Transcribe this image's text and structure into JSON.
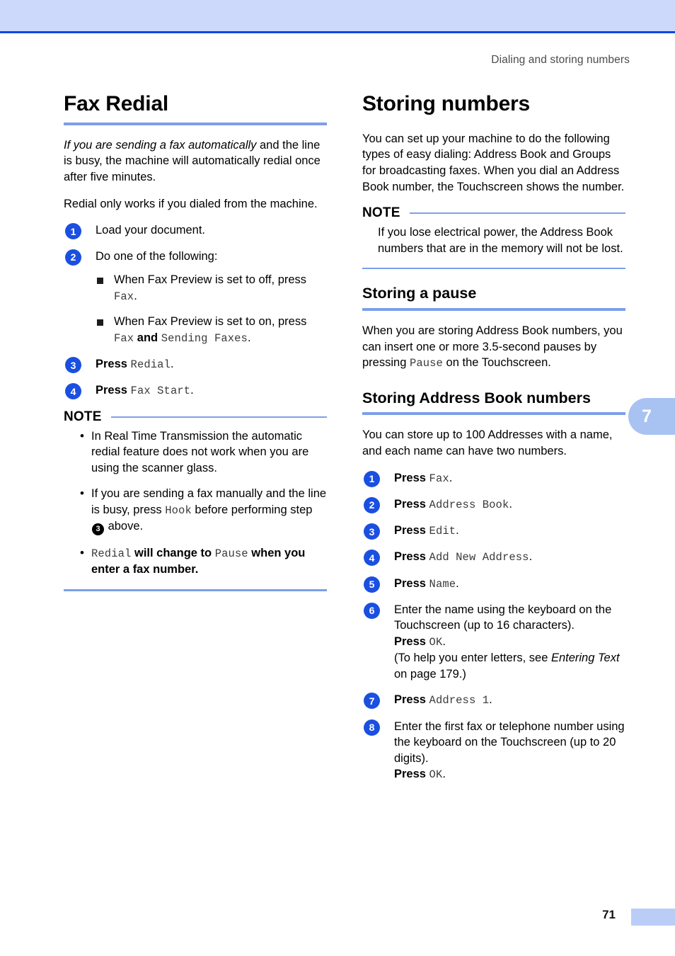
{
  "page": {
    "running_header": "Dialing and storing numbers",
    "folio": "71",
    "chapter_tab": "7",
    "accent_band": "#ccd9fb",
    "accent_rule": "#0d47e0",
    "accent_heading_rule": "#7d9fe8",
    "step_badge_color": "#1a4fe0"
  },
  "left_column": {
    "section": {
      "title": "Fax Redial",
      "intro_italic": "If you are sending a fax automatically",
      "intro_rest": " and the line is busy, the machine will automatically redial once after five minutes.",
      "paragraph2": "Redial only works if you dialed from the machine."
    },
    "steps": [
      {
        "num": "1",
        "text": "Load your document."
      },
      {
        "num": "2",
        "text": "Do one of the following:"
      },
      {
        "num": "3",
        "press": "Press ",
        "code": "Redial",
        "tail": "."
      },
      {
        "num": "4",
        "press": "Press ",
        "code": "Fax Start",
        "tail": "."
      }
    ],
    "sub_bullets": [
      {
        "text": "When Fax Preview is set to off, press ",
        "code": "Fax",
        "tail": "."
      },
      {
        "text": "When Fax Preview is set to on, press ",
        "code": "Fax",
        "mid": " and ",
        "code2": "Sending Faxes",
        "tail": "."
      }
    ],
    "note": {
      "label": "NOTE",
      "items": [
        {
          "text": "In Real Time Transmission the automatic redial feature does not work when you are using the scanner glass."
        },
        {
          "pre": "If you are sending a fax manually and the line is busy, press ",
          "code": "Hook",
          "mid": " before performing step ",
          "badge": "3",
          "tail": " above."
        },
        {
          "code": "Redial",
          "mid": " will change to ",
          "code2": "Pause",
          "tail": " when you enter a fax number."
        }
      ]
    }
  },
  "right_column": {
    "section": {
      "title": "Storing numbers",
      "intro": "You can set up your machine to do the following types of easy dialing: Address Book and Groups for broadcasting faxes. When you dial an Address Book number, the Touchscreen shows the number."
    },
    "note": {
      "label": "NOTE",
      "text": "If you lose electrical power, the Address Book numbers that are in the memory will not be lost."
    },
    "pause_section": {
      "title": "Storing a pause",
      "pre": "When you are storing Address Book numbers, you can insert one or more 3.5-second pauses by pressing ",
      "code": "Pause",
      "tail": " on the Touchscreen."
    },
    "address_section": {
      "title": "Storing Address Book numbers",
      "intro": "You can store up to 100 Addresses with a name, and each name can have two numbers.",
      "steps": [
        {
          "num": "1",
          "press": "Press ",
          "code": "Fax",
          "tail": "."
        },
        {
          "num": "2",
          "press": "Press ",
          "code": "Address Book",
          "tail": "."
        },
        {
          "num": "3",
          "press": "Press ",
          "code": "Edit",
          "tail": "."
        },
        {
          "num": "4",
          "press": "Press ",
          "code": "Add New Address",
          "tail": "."
        },
        {
          "num": "5",
          "press": "Press ",
          "code": "Name",
          "tail": "."
        },
        {
          "num": "6",
          "line1": "Enter the name using the keyboard on the Touchscreen (up to 16 characters).",
          "press2": "Press ",
          "code2": "OK",
          "tail2": ".",
          "ref_pre": "(To help you enter letters, see ",
          "ref_italic": "Entering Text",
          "ref_post": " on page 179.)"
        },
        {
          "num": "7",
          "press": "Press ",
          "code": "Address 1",
          "tail": "."
        },
        {
          "num": "8",
          "line1": "Enter the first fax or telephone number using the keyboard on the Touchscreen (up to 20 digits).",
          "press2": "Press ",
          "code2": "OK",
          "tail2": "."
        }
      ]
    }
  }
}
